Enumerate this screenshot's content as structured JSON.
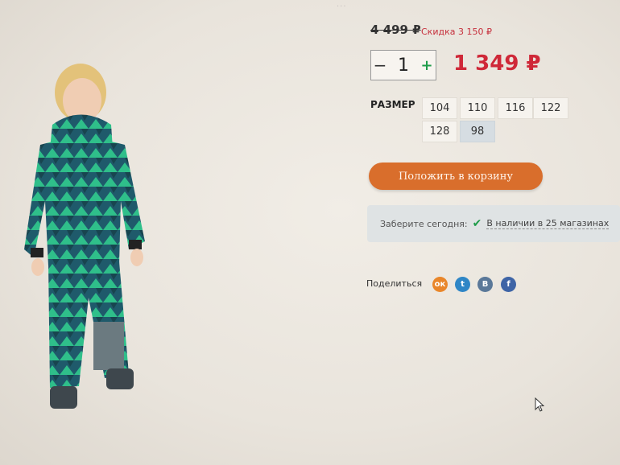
{
  "top_glimpse": "...",
  "pricing": {
    "old_price": "4 499 ₽",
    "discount": "Скидка 3 150 ₽",
    "new_price": "1 349 ₽"
  },
  "quantity": {
    "minus": "−",
    "value": "1",
    "plus": "+"
  },
  "sizes": {
    "label": "РАЗМЕР",
    "options": [
      "104",
      "110",
      "116",
      "122",
      "128",
      "98"
    ],
    "selected": "98"
  },
  "cart_button": "Положить в корзину",
  "availability": {
    "label": "Заберите сегодня:",
    "link": "В наличии в 25 магазинах"
  },
  "share": {
    "label": "Поделиться",
    "networks": [
      "ok-icon",
      "twitter-icon",
      "vk-icon",
      "facebook-icon"
    ],
    "glyphs": [
      "ок",
      "t",
      "B",
      "f"
    ],
    "colors": [
      "#e9862a",
      "#2f86c6",
      "#5a7899",
      "#3e64a6"
    ]
  }
}
